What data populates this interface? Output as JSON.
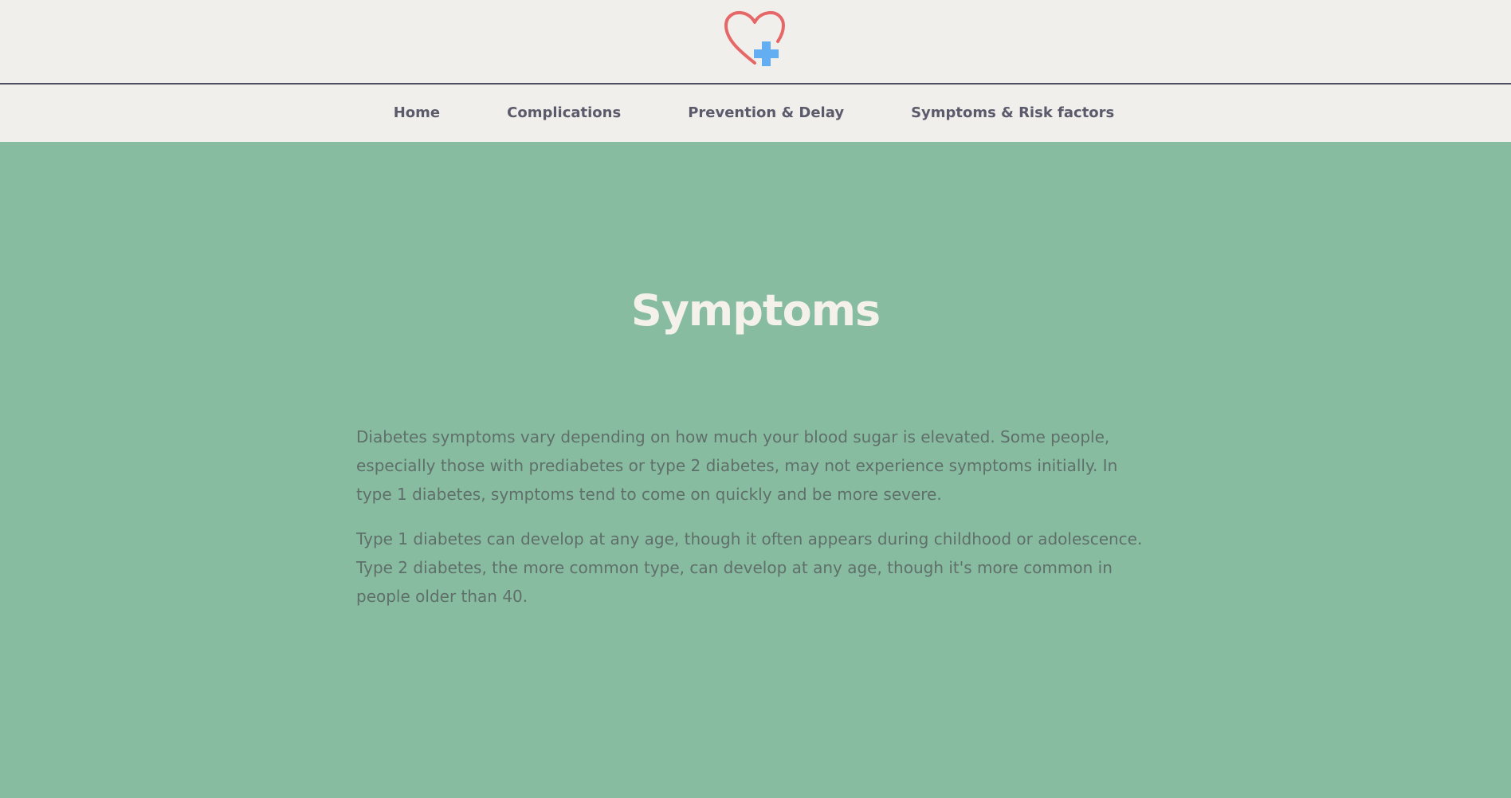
{
  "colors": {
    "header_background": "#f1efeb",
    "main_background": "#88bca0",
    "nav_text": "#5a5a6b",
    "title_text": "#f4f1ea",
    "body_text": "#5f6f6a",
    "logo_heart": "#e66767",
    "logo_cross": "#63aef3"
  },
  "header": {
    "logo_icon": "heart-with-plus-icon"
  },
  "nav": {
    "items": [
      {
        "label": "Home"
      },
      {
        "label": "Complications"
      },
      {
        "label": "Prevention & Delay"
      },
      {
        "label": "Symptoms & Risk factors"
      }
    ]
  },
  "main": {
    "title": "Symptoms",
    "paragraphs": [
      "Diabetes symptoms vary depending on how much your blood sugar is elevated. Some people, especially those with prediabetes or type 2 diabetes, may not experience symptoms initially. In type 1 diabetes, symptoms tend to come on quickly and be more severe.",
      "Type 1 diabetes can develop at any age, though it often appears during childhood or adolescence. Type 2 diabetes, the more common type, can develop at any age, though it's more common in people older than 40."
    ]
  }
}
